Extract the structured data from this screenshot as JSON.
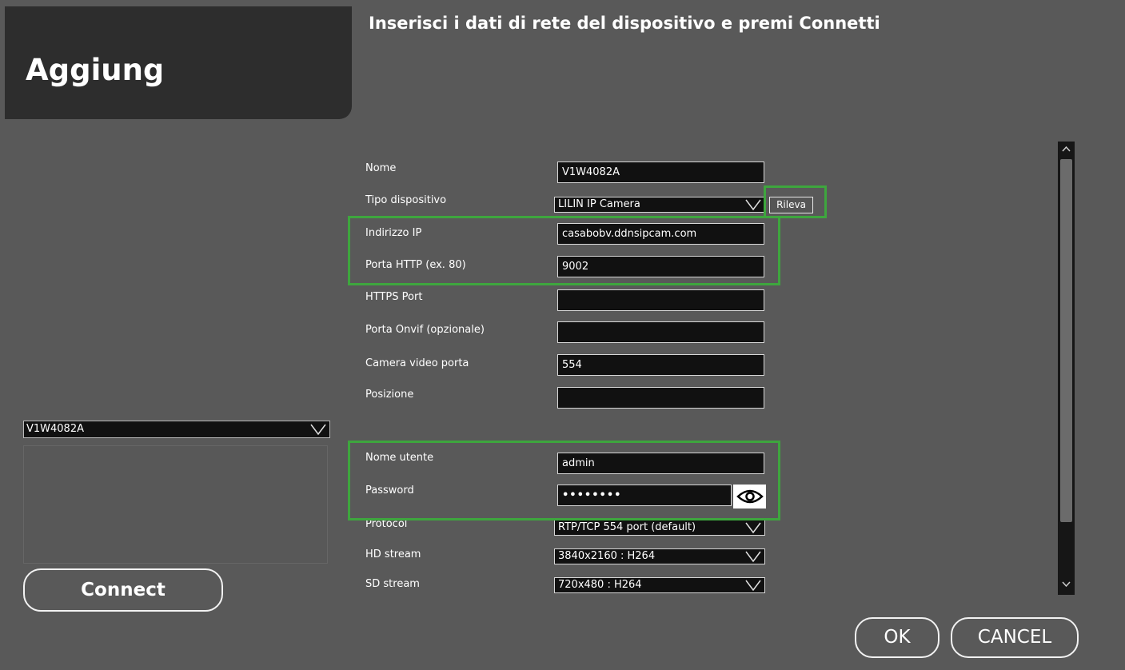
{
  "header": {
    "tab_title": "Aggiung",
    "instruction": "Inserisci i dati di rete del dispositivo e premi Connetti"
  },
  "left_panel": {
    "device_select_value": "V1W4082A",
    "connect_label": "Connect"
  },
  "form": {
    "nome": {
      "label": "Nome",
      "value": "V1W4082A"
    },
    "tipo_dispositivo": {
      "label": "Tipo dispositivo",
      "value": "LILIN IP Camera"
    },
    "rileva_label": "Rileva",
    "indirizzo_ip": {
      "label": "Indirizzo IP",
      "value": "casabobv.ddnsipcam.com"
    },
    "porta_http": {
      "label": "Porta HTTP (ex. 80)",
      "value": "9002"
    },
    "https_port": {
      "label": "HTTPS Port",
      "value": ""
    },
    "porta_onvif": {
      "label": "Porta Onvif (opzionale)",
      "value": ""
    },
    "camera_video_porta": {
      "label": "Camera video porta",
      "value": "554"
    },
    "posizione": {
      "label": "Posizione",
      "value": ""
    },
    "nome_utente": {
      "label": "Nome utente",
      "value": "admin"
    },
    "password": {
      "label": "Password",
      "value": "••••••••"
    },
    "protocol": {
      "label": "Protocol",
      "value": "RTP/TCP 554 port (default)"
    },
    "hd_stream": {
      "label": "HD stream",
      "value": "3840x2160 : H264"
    },
    "sd_stream": {
      "label": "SD stream",
      "value": "720x480 : H264"
    }
  },
  "footer": {
    "ok_label": "OK",
    "cancel_label": "CANCEL"
  },
  "colors": {
    "background": "#595959",
    "tab_background": "#2d2d2d",
    "highlight": "#3ea63e",
    "field_background": "#111111"
  },
  "icons": [
    "chevron-down-icon",
    "eye-icon",
    "scroll-up-icon",
    "scroll-down-icon"
  ]
}
